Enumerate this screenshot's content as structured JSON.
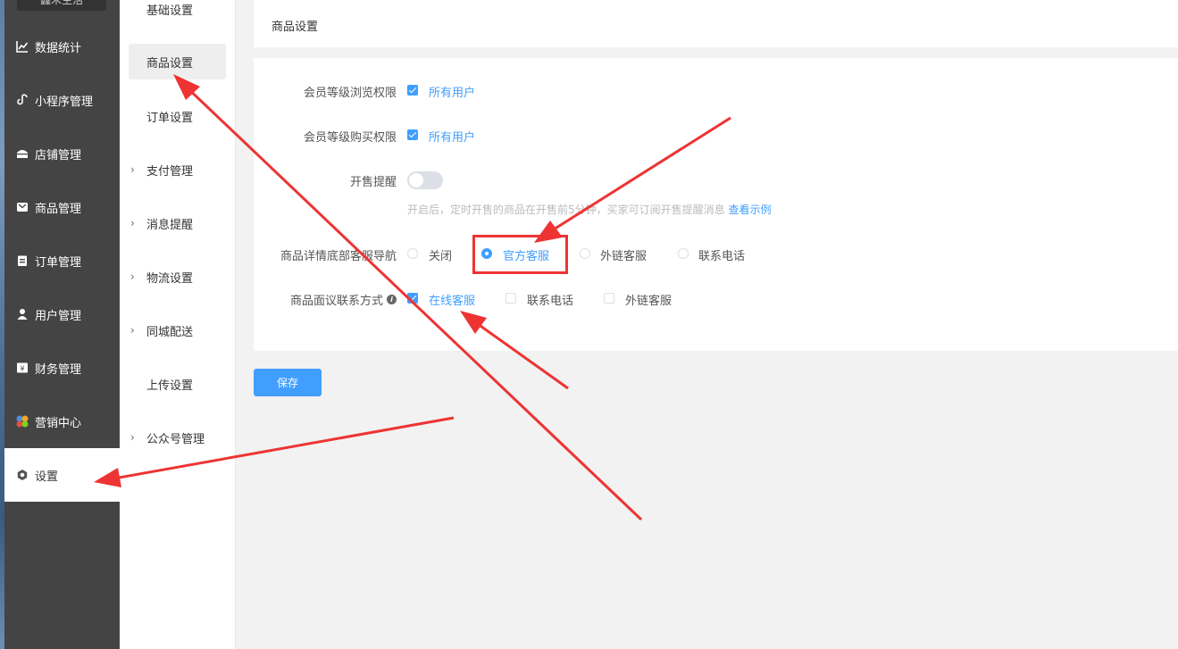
{
  "sidebar": {
    "logo": "鑫禾生活",
    "items": [
      {
        "label": "数据统计",
        "icon": "chart-line-icon"
      },
      {
        "label": "小程序管理",
        "icon": "miniapp-icon"
      },
      {
        "label": "店铺管理",
        "icon": "store-icon"
      },
      {
        "label": "商品管理",
        "icon": "goods-icon"
      },
      {
        "label": "订单管理",
        "icon": "order-icon"
      },
      {
        "label": "用户管理",
        "icon": "user-icon"
      },
      {
        "label": "财务管理",
        "icon": "finance-icon"
      },
      {
        "label": "营销中心",
        "icon": "marketing-icon"
      },
      {
        "label": "设置",
        "icon": "gear-icon",
        "active": true
      }
    ]
  },
  "subnav": {
    "items": [
      {
        "label": "基础设置"
      },
      {
        "label": "商品设置",
        "active": true
      },
      {
        "label": "订单设置"
      },
      {
        "label": "支付管理",
        "expandable": true
      },
      {
        "label": "消息提醒",
        "expandable": true
      },
      {
        "label": "物流设置",
        "expandable": true
      },
      {
        "label": "同城配送",
        "expandable": true
      },
      {
        "label": "上传设置"
      },
      {
        "label": "公众号管理",
        "expandable": true
      }
    ]
  },
  "header": {
    "title": "商品设置"
  },
  "form": {
    "browse_permission": {
      "label": "会员等级浏览权限",
      "option": "所有用户",
      "checked": true
    },
    "buy_permission": {
      "label": "会员等级购买权限",
      "option": "所有用户",
      "checked": true
    },
    "sale_reminder": {
      "label": "开售提醒",
      "enabled": false,
      "hint": "开启后，定时开售的商品在开售前5分钟，买家可订阅开售提醒消息",
      "hint_link": "查看示例"
    },
    "service_nav": {
      "label": "商品详情底部客服导航",
      "options": [
        "关闭",
        "官方客服",
        "外链客服",
        "联系电话"
      ],
      "selected": "官方客服"
    },
    "contact_method": {
      "label": "商品面议联系方式",
      "options": [
        {
          "label": "在线客服",
          "checked": true
        },
        {
          "label": "联系电话",
          "checked": false
        },
        {
          "label": "外链客服",
          "checked": false
        }
      ]
    }
  },
  "actions": {
    "save_label": "保存"
  },
  "colors": {
    "accent": "#409eff",
    "sidebar_bg": "#444444",
    "annotation_red": "#ee3333"
  }
}
